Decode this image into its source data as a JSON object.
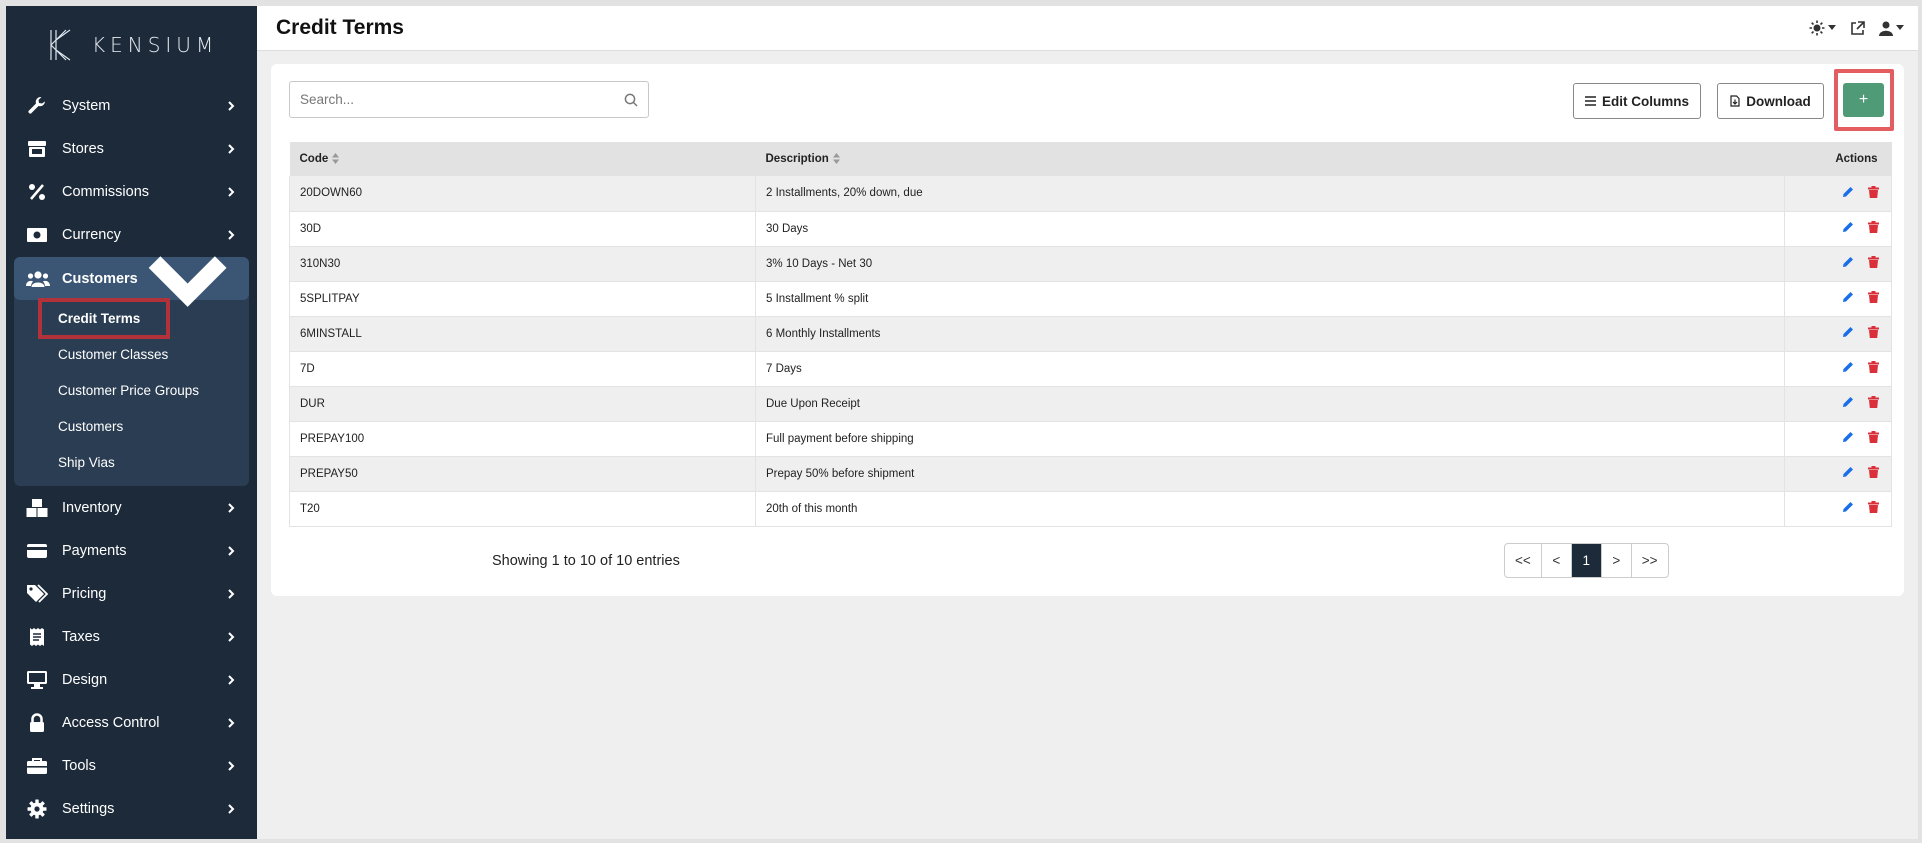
{
  "brand": {
    "name": "KENSIUM"
  },
  "header": {
    "title": "Credit Terms"
  },
  "sidebar": {
    "items_top": [
      {
        "label": "System",
        "icon": "wrench-icon"
      },
      {
        "label": "Stores",
        "icon": "store-icon"
      },
      {
        "label": "Commissions",
        "icon": "percent-icon"
      },
      {
        "label": "Currency",
        "icon": "money-bill-icon"
      }
    ],
    "customers": {
      "label": "Customers",
      "sub": [
        "Credit Terms",
        "Customer Classes",
        "Customer Price Groups",
        "Customers",
        "Ship Vias"
      ]
    },
    "items_bottom": [
      {
        "label": "Inventory",
        "icon": "boxes-icon"
      },
      {
        "label": "Payments",
        "icon": "credit-card-icon"
      },
      {
        "label": "Pricing",
        "icon": "tags-icon"
      },
      {
        "label": "Taxes",
        "icon": "receipt-icon"
      },
      {
        "label": "Design",
        "icon": "desktop-icon"
      },
      {
        "label": "Access Control",
        "icon": "lock-icon"
      },
      {
        "label": "Tools",
        "icon": "toolbox-icon"
      },
      {
        "label": "Settings",
        "icon": "gear-icon"
      }
    ]
  },
  "toolbar": {
    "search_placeholder": "Search...",
    "edit_columns_label": "Edit Columns",
    "download_label": "Download",
    "add_label": "+"
  },
  "table": {
    "headers": {
      "code": "Code",
      "description": "Description",
      "actions": "Actions"
    },
    "rows": [
      {
        "code": "20DOWN60",
        "description": "2 Installments, 20% down, due"
      },
      {
        "code": "30D",
        "description": "30 Days"
      },
      {
        "code": "310N30",
        "description": "3% 10 Days - Net 30"
      },
      {
        "code": "5SPLITPAY",
        "description": "5 Installment % split"
      },
      {
        "code": "6MINSTALL",
        "description": "6 Monthly Installments"
      },
      {
        "code": "7D",
        "description": "7 Days"
      },
      {
        "code": "DUR",
        "description": "Due Upon Receipt"
      },
      {
        "code": "PREPAY100",
        "description": "Full payment before shipping"
      },
      {
        "code": "PREPAY50",
        "description": "Prepay 50% before shipment"
      },
      {
        "code": "T20",
        "description": "20th of this month"
      }
    ]
  },
  "footer": {
    "info": "Showing 1 to 10 of 10 entries",
    "pager": [
      "<<",
      "<",
      "1",
      ">",
      ">>"
    ],
    "current_page": "1"
  },
  "colors": {
    "sidebar_bg": "#1c2a3a",
    "accent_green": "#4f9a77",
    "edit_blue": "#1a6fe8",
    "delete_red": "#d9303a",
    "highlight_red": "#e35d61"
  }
}
